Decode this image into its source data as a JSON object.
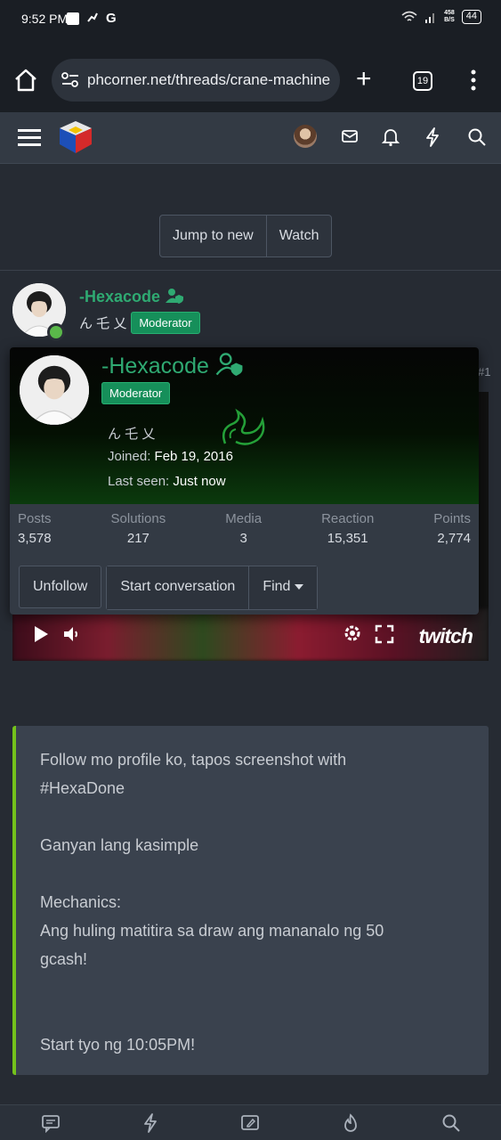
{
  "status_bar": {
    "time": "9:52 PM",
    "network_speed_value": "458",
    "network_speed_unit": "B/S",
    "battery": "44"
  },
  "browser": {
    "url": "phcorner.net/threads/crane-machine",
    "tab_count": "19"
  },
  "thread_actions": {
    "jump_to_new": "Jump to new",
    "watch": "Watch"
  },
  "post": {
    "author": "-Hexacode",
    "title_text": "ん 乇 乂",
    "badge": "Moderator",
    "post_number": "#1"
  },
  "member_card": {
    "name": "-Hexacode",
    "badge": "Moderator",
    "title_text": "ん 乇 乂",
    "joined_label": "Joined:",
    "joined_value": "Feb 19, 2016",
    "last_seen_label": "Last seen:",
    "last_seen_value": "Just now",
    "stats": [
      {
        "label": "Posts",
        "value": "3,578"
      },
      {
        "label": "Solutions",
        "value": "217"
      },
      {
        "label": "Media",
        "value": "3"
      },
      {
        "label": "Reaction",
        "value": "15,351"
      },
      {
        "label": "Points",
        "value": "2,774"
      }
    ],
    "buttons": {
      "unfollow": "Unfollow",
      "start_conversation": "Start conversation",
      "find": "Find"
    }
  },
  "video": {
    "provider": "twitch"
  },
  "quote": {
    "lines": [
      "Follow mo profile ko, tapos screenshot with",
      "#HexaDone",
      "Ganyan lang kasimple",
      "Mechanics:",
      "Ang huling matitira sa draw ang mananalo ng 50",
      "gcash!",
      "Start tyo ng 10:05PM!"
    ]
  },
  "colors": {
    "accent_green": "#2faa72",
    "quote_border": "#74c21c",
    "page_bg": "#262b33"
  }
}
